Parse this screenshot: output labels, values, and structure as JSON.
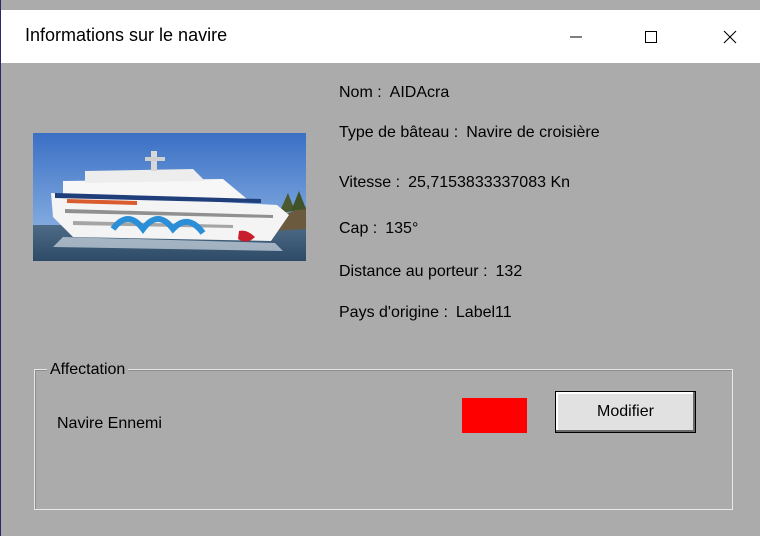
{
  "window": {
    "title": "Informations sur le navire",
    "controls": {
      "minimize_icon": "minimize-icon",
      "maximize_icon": "maximize-icon",
      "close_icon": "close-icon"
    }
  },
  "ship": {
    "image_icon": "cruise-ship-photo",
    "name_label": "Nom :",
    "name_value": "AIDAcra",
    "type_label": "Type de bâteau :",
    "type_value": "Navire de croisière",
    "speed_label": "Vitesse :",
    "speed_value": "25,7153833337083 Kn",
    "heading_label": "Cap :",
    "heading_value": "135°",
    "distance_label": "Distance au porteur :",
    "distance_value": "132",
    "country_label": "Pays d'origine :",
    "country_value": "Label11"
  },
  "affectation": {
    "group_title": "Affectation",
    "status_label": "Navire Ennemi",
    "status_color": "#ff0000",
    "modify_button": "Modifier"
  }
}
